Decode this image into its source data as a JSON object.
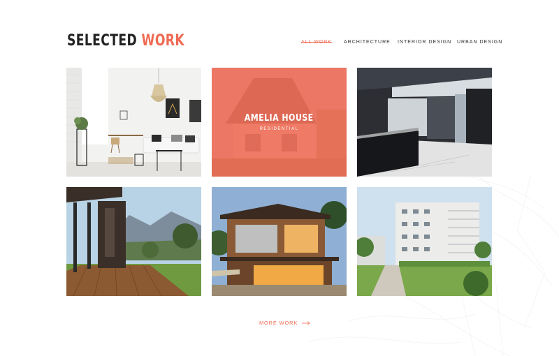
{
  "section": {
    "title_part1": "SELECTED",
    "title_part2": "WORK"
  },
  "filters": [
    {
      "label": "ALL WORK",
      "active": true
    },
    {
      "label": "ARCHITECTURE",
      "active": false
    },
    {
      "label": "INTERIOR DESIGN",
      "active": false
    },
    {
      "label": "URBAN DESIGN",
      "active": false
    }
  ],
  "projects": [
    {
      "image": "living-room-interior"
    },
    {
      "image": "house-exterior",
      "title": "AMELIA HOUSE",
      "category": "RESIDENTIAL",
      "hovered": true
    },
    {
      "image": "office-reception-interior"
    },
    {
      "image": "wooden-deck-mountain-view"
    },
    {
      "image": "modern-house-dusk"
    },
    {
      "image": "apartment-buildings"
    }
  ],
  "more_link": {
    "label": "MORE WORK",
    "icon": "arrow-right-icon"
  },
  "colors": {
    "accent": "#ef6a53",
    "text": "#222222",
    "background": "#ffffff"
  }
}
